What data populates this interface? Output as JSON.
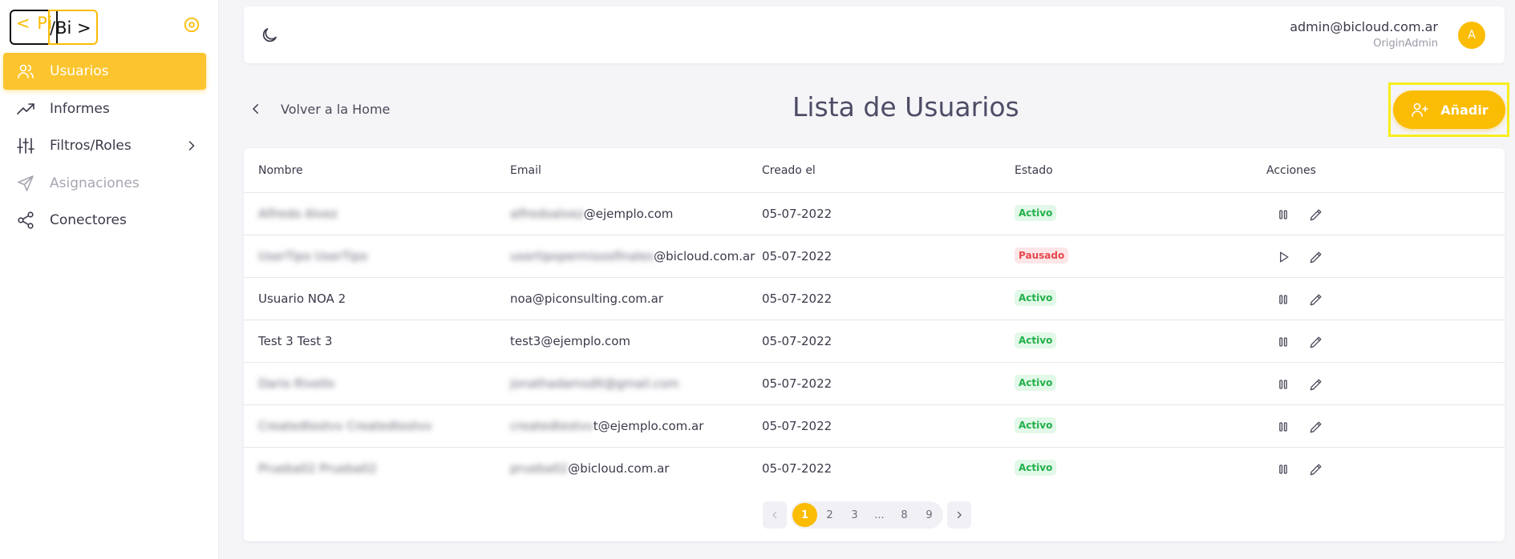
{
  "colors": {
    "accent": "#fbbc04",
    "active_badge": "#22b04a",
    "paused_badge": "#e5484d"
  },
  "logo": {
    "left": "< Pi",
    "right": "/Bi >"
  },
  "sidebar": {
    "items": [
      {
        "label": "Usuarios",
        "icon": "users-icon",
        "active": true
      },
      {
        "label": "Informes",
        "icon": "trending-up-icon"
      },
      {
        "label": "Filtros/Roles",
        "icon": "sliders-icon",
        "has_submenu": true
      },
      {
        "label": "Asignaciones",
        "icon": "send-icon",
        "disabled": true
      },
      {
        "label": "Conectores",
        "icon": "share-icon"
      }
    ]
  },
  "header": {
    "theme_icon": "moon-icon",
    "user_email": "admin@bicloud.com.ar",
    "user_role": "OriginAdmin",
    "avatar_initial": "A"
  },
  "page": {
    "back_label": "Volver a la Home",
    "title": "Lista de Usuarios",
    "add_label": "Añadir"
  },
  "table": {
    "columns": [
      "Nombre",
      "Email",
      "Creado el",
      "Estado",
      "Acciones"
    ],
    "rows": [
      {
        "name": "Alfredo Alvez",
        "name_blurred": true,
        "email_hidden": "alfredoalvez",
        "email_visible": "@ejemplo.com",
        "created": "05-07-2022",
        "status": "Activo",
        "status_type": "activo",
        "action_icon": "pause-icon"
      },
      {
        "name": "UserTipo UserTipo",
        "name_blurred": true,
        "email_hidden": "usertipopermisosfinales",
        "email_visible": "@bicloud.com.ar",
        "created": "05-07-2022",
        "status": "Pausado",
        "status_type": "pausado",
        "action_icon": "play-icon"
      },
      {
        "name": "Usuario NOA 2",
        "name_blurred": false,
        "email_hidden": "",
        "email_visible": "noa@piconsulting.com.ar",
        "created": "05-07-2022",
        "status": "Activo",
        "status_type": "activo",
        "action_icon": "pause-icon"
      },
      {
        "name": "Test 3 Test 3",
        "name_blurred": false,
        "email_hidden": "",
        "email_visible": "test3@ejemplo.com",
        "created": "05-07-2022",
        "status": "Activo",
        "status_type": "activo",
        "action_icon": "pause-icon"
      },
      {
        "name": "Dario Rivello",
        "name_blurred": true,
        "email_hidden": "jonathadamsdlt@gmail.com",
        "email_visible": "",
        "created": "05-07-2022",
        "status": "Activo",
        "status_type": "activo",
        "action_icon": "pause-icon"
      },
      {
        "name": "Createdtestvv Createdtestvv",
        "name_blurred": true,
        "email_hidden": "createdtestvv",
        "email_visible": "t@ejemplo.com.ar",
        "created": "05-07-2022",
        "status": "Activo",
        "status_type": "activo",
        "action_icon": "pause-icon"
      },
      {
        "name": "Prueba02 Prueba02",
        "name_blurred": true,
        "email_hidden": "prueba02",
        "email_visible": "@bicloud.com.ar",
        "created": "05-07-2022",
        "status": "Activo",
        "status_type": "activo",
        "action_icon": "pause-icon"
      }
    ]
  },
  "pagination": {
    "pages": [
      "1",
      "2",
      "3",
      "...",
      "8",
      "9"
    ],
    "current": "1"
  }
}
